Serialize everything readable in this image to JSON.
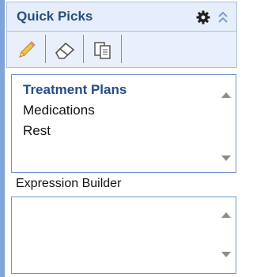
{
  "quick_picks": {
    "title": "Quick Picks",
    "icons": {
      "settings": "gear-icon",
      "collapse": "double-chevron-up-icon"
    }
  },
  "toolbar": {
    "tools": [
      {
        "name": "pencil-icon"
      },
      {
        "name": "eraser-icon"
      },
      {
        "name": "copy-icon"
      }
    ]
  },
  "picks_list": {
    "items": [
      {
        "label": "Treatment Plans",
        "selected": true
      },
      {
        "label": "Medications",
        "selected": false
      },
      {
        "label": "Rest",
        "selected": false
      }
    ]
  },
  "expression_builder": {
    "label": "Expression Builder",
    "value": ""
  },
  "colors": {
    "accent": "#2b4d80",
    "header_bg": "#e6eefb",
    "border": "#6f93cc",
    "stripe": "#7ea4d9"
  }
}
